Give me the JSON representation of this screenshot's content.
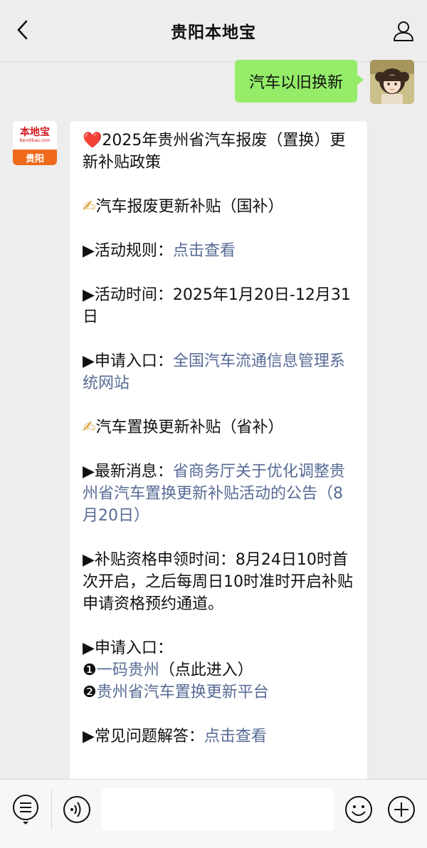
{
  "header": {
    "title": "贵阳本地宝",
    "back_icon": "chevron-left-icon",
    "profile_icon": "person-icon"
  },
  "outgoing": {
    "text": "汽车以旧换新"
  },
  "bot_logo": {
    "main": "本地宝",
    "sub": "Bendibao.com",
    "city": "贵阳"
  },
  "message": {
    "p1_emoji": "❤️",
    "p1_text": "2025年贵州省汽车报废（置换）更新补贴政策",
    "p2_emoji": "✍",
    "p2_text": "汽车报废更新补贴（国补）",
    "p3_prefix": "▶活动规则：",
    "p3_link": "点击查看",
    "p4_text": "▶活动时间：2025年1月20日-12月31日",
    "p5_prefix": "▶申请入口：",
    "p5_link": "全国汽车流通信息管理系统网站",
    "p6_emoji": "✍",
    "p6_text": "汽车置换更新补贴（省补）",
    "p7_prefix": "▶最新消息：",
    "p7_link": "省商务厅关于优化调整贵州省汽车置换更新补贴活动的公告（8月20日）",
    "p8_text": "▶补贴资格申领时间：8月24日10时首次开启，之后每周日10时准时开启补贴申请资格预约通道。",
    "p9_title": "▶申请入口：",
    "p9_line1_marker": "❶",
    "p9_line1_link": "一码贵州",
    "p9_line1_suffix": "（点此进入）",
    "p9_line2_marker": "❷",
    "p9_line2_link": "贵州省汽车置换更新平台",
    "p10_prefix": "▶常见问题解答：",
    "p10_link": "点击查看"
  },
  "bottom_bar": {
    "icons": [
      "menu-icon",
      "voice-icon",
      "emoji-icon",
      "plus-icon"
    ]
  },
  "colors": {
    "background": "#ededed",
    "bubble_out": "#95ec69",
    "link": "#576b95",
    "logo_orange": "#ef6b1b",
    "logo_red": "#d3171f"
  }
}
